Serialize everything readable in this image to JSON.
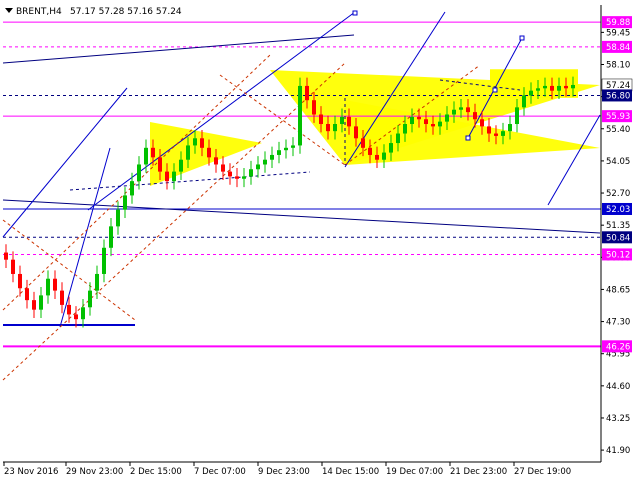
{
  "chart_data": {
    "type": "candlestick",
    "title": "BRENT,H4",
    "ohlc_values": "57.17 57.28 57.16 57.24",
    "ylim": [
      41.4,
      60.6
    ],
    "y_ticks": [
      59.45,
      58.1,
      56.75,
      55.4,
      54.05,
      52.7,
      51.35,
      50.0,
      48.65,
      47.3,
      45.95,
      44.6,
      43.25,
      41.9
    ],
    "x_labels": [
      "23 Nov 2016",
      "29 Nov 23:00",
      "2 Dec 15:00",
      "7 Dec 07:00",
      "9 Dec 23:00",
      "14 Dec 15:00",
      "19 Dec 07:00",
      "21 Dec 23:00",
      "27 Dec 19:00"
    ],
    "current_price": 57.24,
    "level_labels": [
      {
        "value": 59.88,
        "text": "59.88",
        "color": "#ff00ff"
      },
      {
        "value": 58.84,
        "text": "58.84",
        "color": "#ff00ff"
      },
      {
        "value": 57.24,
        "text": "57.24",
        "color": "#ffffff"
      },
      {
        "value": 56.8,
        "text": "56.80",
        "color": "#000080"
      },
      {
        "value": 55.93,
        "text": "55.93",
        "color": "#ff00ff"
      },
      {
        "value": 52.03,
        "text": "52.03",
        "color": "#0000cd"
      },
      {
        "value": 50.84,
        "text": "50.84",
        "color": "#000080"
      },
      {
        "value": 50.12,
        "text": "50.12",
        "color": "#ff00ff"
      },
      {
        "value": 46.26,
        "text": "46.26",
        "color": "#ff00ff"
      }
    ],
    "close_series": [
      49.9,
      49.3,
      48.7,
      48.2,
      47.8,
      48.4,
      49.1,
      48.6,
      48.0,
      47.6,
      47.4,
      47.9,
      48.6,
      49.3,
      50.4,
      51.3,
      52.0,
      52.6,
      53.2,
      53.9,
      54.6,
      54.2,
      53.6,
      53.2,
      53.6,
      54.1,
      54.7,
      55.0,
      54.6,
      54.2,
      53.9,
      53.6,
      53.4,
      53.3,
      53.4,
      53.7,
      53.9,
      54.1,
      54.3,
      54.5,
      54.6,
      54.7,
      57.2,
      56.6,
      56.0,
      55.6,
      55.3,
      55.6,
      55.9,
      55.5,
      55.0,
      54.6,
      54.3,
      54.1,
      54.4,
      54.8,
      55.2,
      55.6,
      55.9,
      55.8,
      55.6,
      55.5,
      55.7,
      56.0,
      56.2,
      56.3,
      56.1,
      55.8,
      55.5,
      55.2,
      55.1,
      55.3,
      55.6,
      56.3,
      56.8,
      57.0,
      57.1,
      57.2,
      57.0,
      57.2,
      57.1,
      57.24
    ],
    "colors": {
      "up": "#00c000",
      "down": "#ff0000",
      "triangle": "#ffff00",
      "magenta": "#ff00ff",
      "blue": "#0000cd",
      "navy": "#000080",
      "brown": "#cc3300"
    }
  }
}
